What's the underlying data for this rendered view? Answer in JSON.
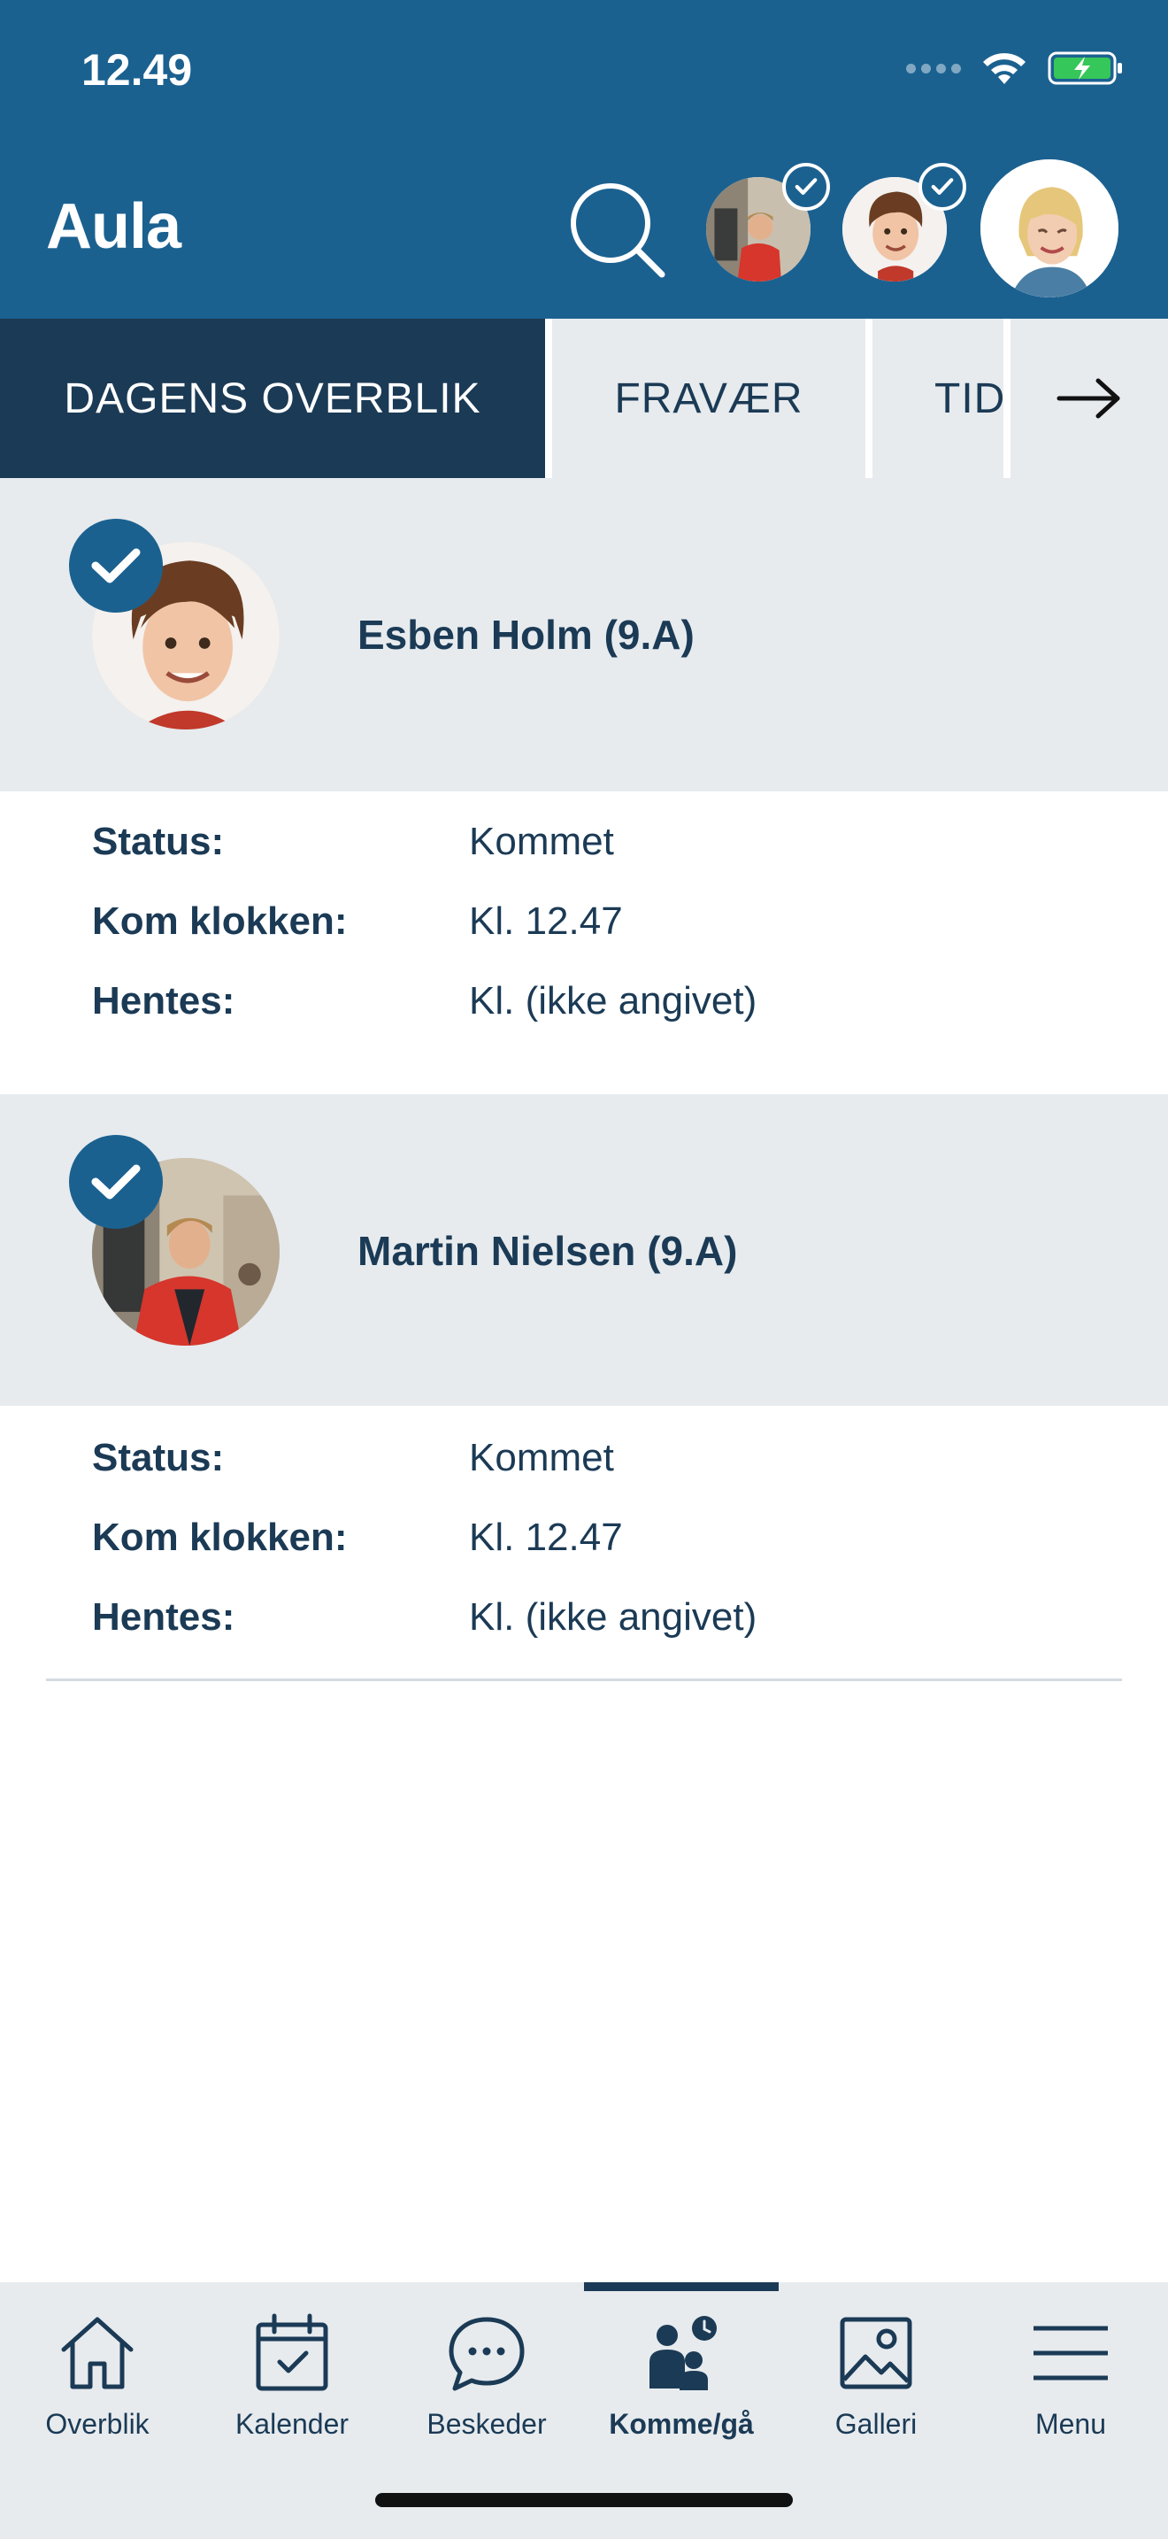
{
  "status_bar": {
    "time": "12.49"
  },
  "header": {
    "app_title": "Aula",
    "search_icon": "search-icon",
    "profiles": [
      {
        "name": "martin-avatar",
        "selected": true
      },
      {
        "name": "esben-avatar",
        "selected": true
      },
      {
        "name": "parent-avatar",
        "selected": false
      }
    ]
  },
  "tabs": [
    {
      "label": "DAGENS OVERBLIK",
      "active": true
    },
    {
      "label": "FRAVÆR",
      "active": false
    },
    {
      "label": "TID",
      "active": false
    }
  ],
  "children": [
    {
      "name": "Esben Holm (9.A)",
      "details": [
        {
          "label": "Status:",
          "value": "Kommet"
        },
        {
          "label": "Kom klokken:",
          "value": "Kl. 12.47"
        },
        {
          "label": "Hentes:",
          "value": "Kl. (ikke angivet)"
        }
      ]
    },
    {
      "name": "Martin Nielsen (9.A)",
      "details": [
        {
          "label": "Status:",
          "value": "Kommet"
        },
        {
          "label": "Kom klokken:",
          "value": "Kl. 12.47"
        },
        {
          "label": "Hentes:",
          "value": "Kl. (ikke angivet)"
        }
      ]
    }
  ],
  "bottom_nav": [
    {
      "label": "Overblik",
      "icon": "home-icon",
      "active": false
    },
    {
      "label": "Kalender",
      "icon": "calendar-icon",
      "active": false
    },
    {
      "label": "Beskeder",
      "icon": "chat-icon",
      "active": false
    },
    {
      "label": "Komme/gå",
      "icon": "people-clock-icon",
      "active": true
    },
    {
      "label": "Galleri",
      "icon": "gallery-icon",
      "active": false
    },
    {
      "label": "Menu",
      "icon": "menu-icon",
      "active": false
    }
  ],
  "colors": {
    "header_bg": "#1b6190",
    "active_tab": "#1b3a55",
    "section_bg": "#e7ebee",
    "text": "#1b3a55"
  }
}
